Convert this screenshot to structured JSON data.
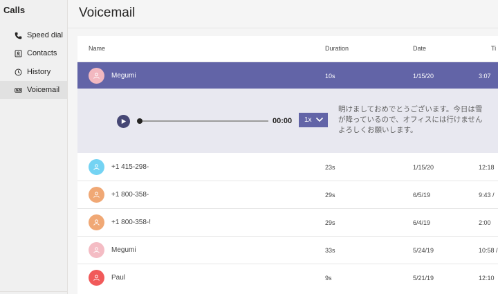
{
  "sidebar": {
    "title": "Calls",
    "items": [
      {
        "label": "Speed dial",
        "icon": "phone-icon"
      },
      {
        "label": "Contacts",
        "icon": "contact-card-icon"
      },
      {
        "label": "History",
        "icon": "clock-icon"
      },
      {
        "label": "Voicemail",
        "icon": "voicemail-icon"
      }
    ]
  },
  "main": {
    "title": "Voicemail",
    "columns": {
      "name": "Name",
      "duration": "Duration",
      "date": "Date",
      "time": "Ti"
    },
    "rows": [
      {
        "name": "Megumi",
        "duration": "10s",
        "date": "1/15/20",
        "time": "3:07",
        "avatar_color": "#f2b8c0",
        "selected": true
      },
      {
        "name": "+1 415-298-",
        "duration": "23s",
        "date": "1/15/20",
        "time": "12:18",
        "avatar_color": "#74d3f3"
      },
      {
        "name": "+1 800-358-",
        "duration": "29s",
        "date": "6/5/19",
        "time": "9:43 /",
        "avatar_color": "#f0a875"
      },
      {
        "name": "+1 800-358-!",
        "duration": "29s",
        "date": "6/4/19",
        "time": "2:00",
        "avatar_color": "#f0a875"
      },
      {
        "name": "Megumi",
        "duration": "33s",
        "date": "5/24/19",
        "time": "10:58 /",
        "avatar_color": "#f4bcc4"
      },
      {
        "name": "Paul",
        "duration": "9s",
        "date": "5/21/19",
        "time": "12:10",
        "avatar_color": "#f15a5a"
      }
    ],
    "player": {
      "elapsed": "00:00",
      "progress": 0,
      "speed": "1x",
      "transcript": [
        "明けましておめでとうございます。今日は雪",
        "が降っているので、オフィスには行けません",
        "よろしくお願いします。"
      ]
    }
  },
  "colors": {
    "accent": "#6264a7",
    "player_bg": "#e8e8f0",
    "play_button": "#464775"
  }
}
